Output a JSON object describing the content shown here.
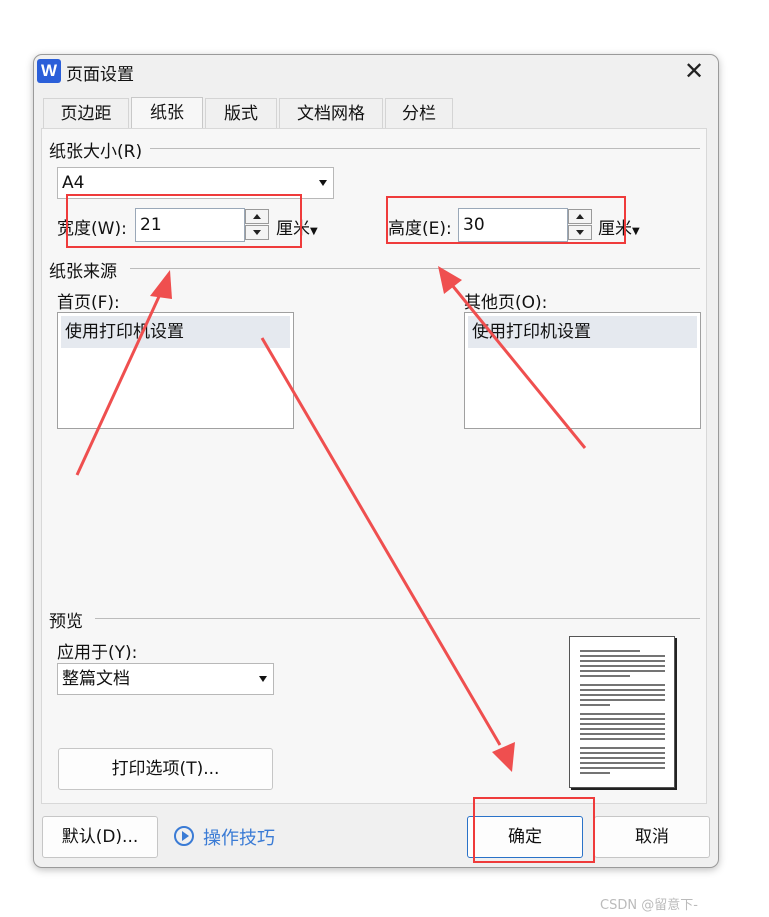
{
  "window": {
    "app_icon": "W",
    "title": "页面设置",
    "close_icon": "✕"
  },
  "tabs": [
    {
      "label": "页边距",
      "active": false
    },
    {
      "label": "纸张",
      "active": true
    },
    {
      "label": "版式",
      "active": false
    },
    {
      "label": "文档网格",
      "active": false
    },
    {
      "label": "分栏",
      "active": false
    }
  ],
  "paper_size": {
    "group_label": "纸张大小(R)",
    "selected": "A4",
    "width_label": "宽度(W):",
    "width_value": "21",
    "width_unit": "厘米",
    "height_label": "高度(E):",
    "height_value": "30",
    "height_unit": "厘米"
  },
  "paper_source": {
    "group_label": "纸张来源",
    "first_page_label": "首页(F):",
    "first_page_items": [
      "使用打印机设置"
    ],
    "other_pages_label": "其他页(O):",
    "other_pages_items": [
      "使用打印机设置"
    ]
  },
  "preview": {
    "group_label": "预览",
    "apply_to_label": "应用于(Y):",
    "apply_to_value": "整篇文档",
    "print_options_label": "打印选项(T)..."
  },
  "footer": {
    "default_label": "默认(D)...",
    "tips_label": "操作技巧",
    "ok_label": "确定",
    "cancel_label": "取消"
  },
  "watermark": "CSDN @留意下-",
  "colors": {
    "accent": "#3a7bd5",
    "annotation": "#ef3b3b",
    "icon_bg": "#2b5fd9"
  }
}
